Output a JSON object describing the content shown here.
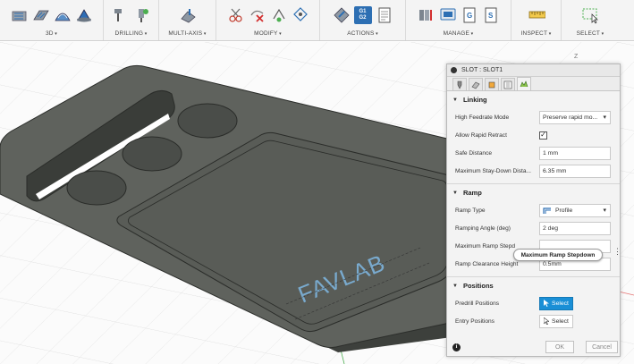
{
  "toolbar": {
    "groups": [
      {
        "label": "3D"
      },
      {
        "label": "DRILLING"
      },
      {
        "label": "MULTI-AXIS"
      },
      {
        "label": "MODIFY"
      },
      {
        "label": "ACTIONS"
      },
      {
        "label": "MANAGE"
      },
      {
        "label": "INSPECT"
      },
      {
        "label": "SELECT"
      }
    ],
    "g1g2_top": "G1",
    "g1g2_bottom": "G2"
  },
  "viewcube": {
    "z_label": "Z"
  },
  "model": {
    "engraving_text": "FAVLAB"
  },
  "panel": {
    "title": "SLOT : SLOT1",
    "linking": {
      "heading": "Linking",
      "high_feedrate_mode_label": "High Feedrate Mode",
      "high_feedrate_mode_value": "Preserve rapid mo...",
      "allow_rapid_retract_label": "Allow Rapid Retract",
      "allow_rapid_retract_checked": true,
      "check_glyph": "✓",
      "safe_distance_label": "Safe Distance",
      "safe_distance_value": "1 mm",
      "max_stay_down_label": "Maximum Stay-Down Dista...",
      "max_stay_down_value": "6.35 mm"
    },
    "ramp": {
      "heading": "Ramp",
      "ramp_type_label": "Ramp Type",
      "ramp_type_value": "Profile",
      "ramping_angle_label": "Ramping Angle (deg)",
      "ramping_angle_value": "2 deg",
      "max_ramp_stepdown_label": "Maximum Ramp Stepd",
      "max_ramp_stepdown_tooltip": "Maximum Ramp Stepdown",
      "ramp_clearance_label": "Ramp Clearance Height",
      "ramp_clearance_value": "0.5mm"
    },
    "positions": {
      "heading": "Positions",
      "predrill_label": "Predrill Positions",
      "predrill_button": "Select",
      "entry_label": "Entry Positions",
      "entry_button": "Select"
    },
    "footer": {
      "info_glyph": "i",
      "ok": "OK",
      "cancel": "Cancel"
    }
  },
  "colors": {
    "accent": "#1a8fd6",
    "model": "#5f625d",
    "engraving": "#7fb7e3"
  }
}
